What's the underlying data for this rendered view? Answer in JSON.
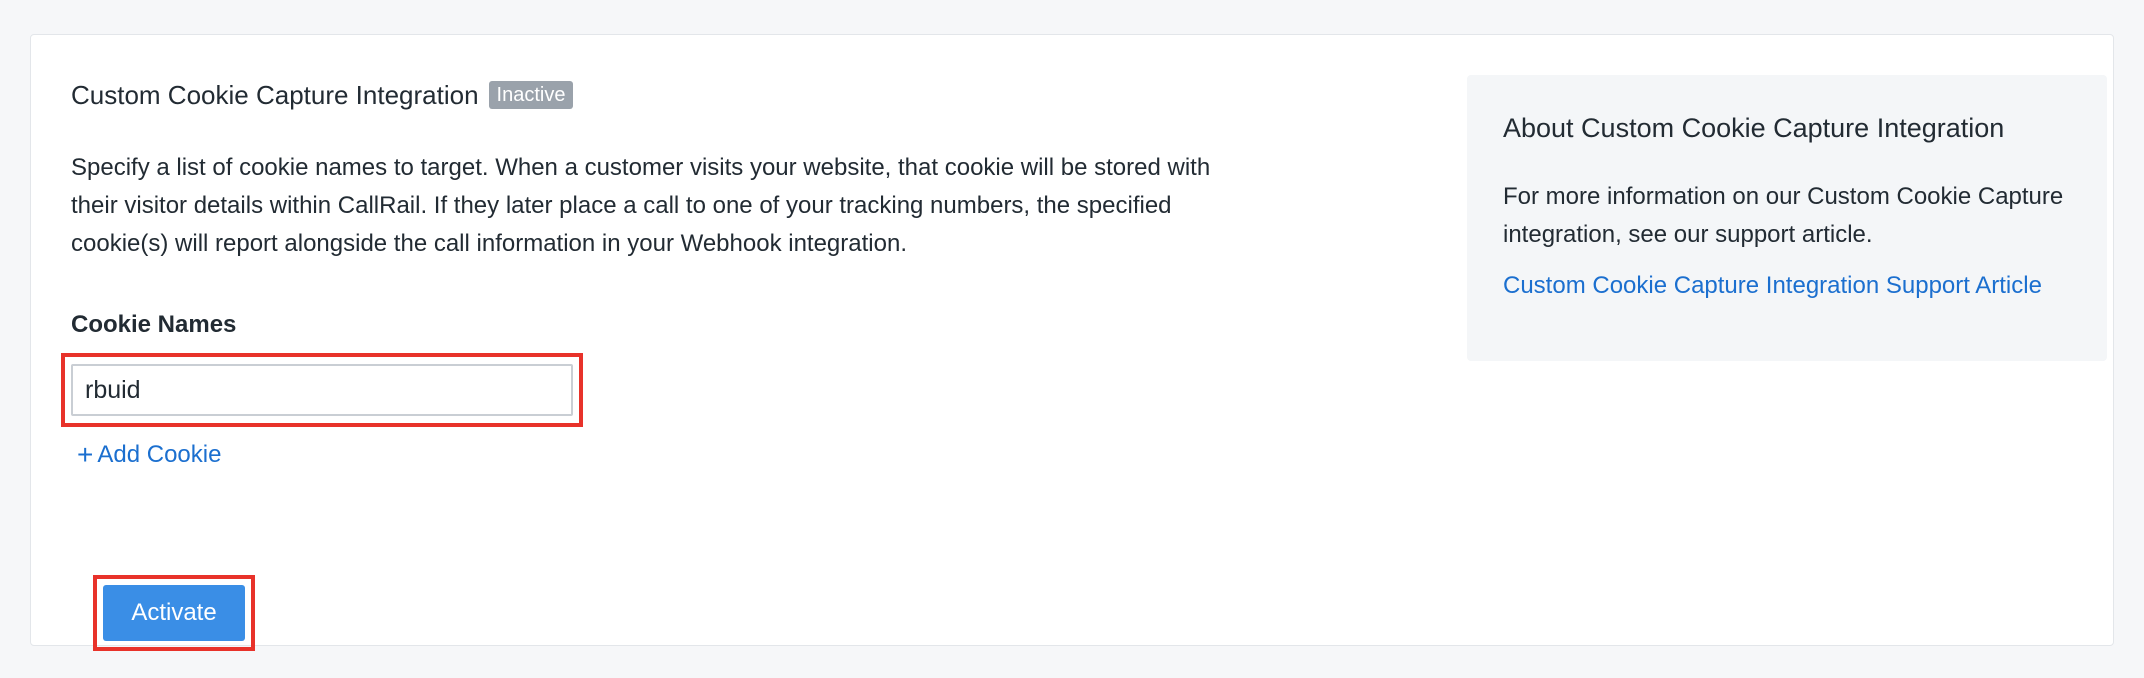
{
  "integration": {
    "title": "Custom Cookie Capture Integration",
    "status": "Inactive",
    "description": "Specify a list of cookie names to target. When a customer visits your website, that cookie will be stored with their visitor details within CallRail. If they later place a call to one of your tracking numbers, the specified cookie(s) will report alongside the call information in your Webhook integration.",
    "field_label": "Cookie Names",
    "cookie_value": "rbuid",
    "add_cookie_label": "Add Cookie",
    "add_cookie_icon": "+",
    "activate_label": "Activate"
  },
  "aside": {
    "title": "About Custom Cookie Capture Integration",
    "text": "For more information on our Custom Cookie Capture integration, see our support article.",
    "link_label": "Custom Cookie Capture Integration Support Article"
  },
  "colors": {
    "accent": "#3a8ee6",
    "link": "#1b6fcf",
    "highlight": "#e8322a",
    "badge": "#9aa2ab"
  }
}
